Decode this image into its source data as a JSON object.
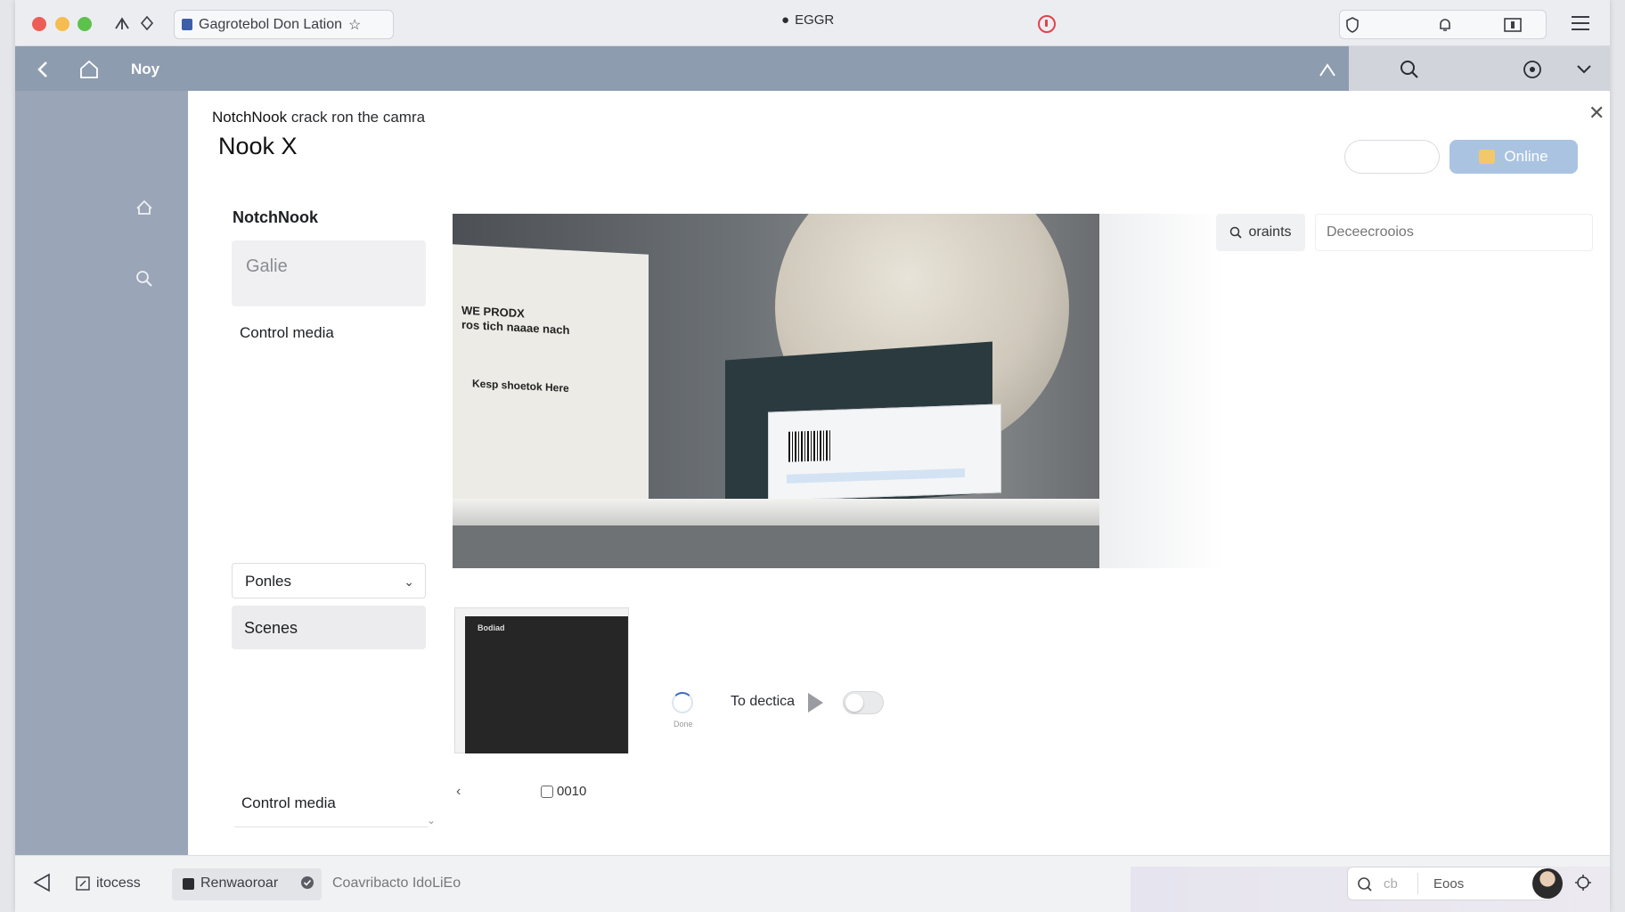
{
  "browser": {
    "url": "Gagrotebol Don Lation",
    "tab_title": "EGGR"
  },
  "appnav": {
    "title": "Noy"
  },
  "panel": {
    "breadcrumb_app": "NotchNook",
    "breadcrumb_text": "crack ron the camra",
    "title": "Nook X",
    "online_button": "Online"
  },
  "left": {
    "section_title": "NotchNook",
    "card_text": "Galie",
    "control_media": "Control media",
    "dropdown_value": "Ponles",
    "scenes": "Scenes",
    "control_media_bottom": "Control media"
  },
  "camera": {
    "book_text_1": "WE PRODX",
    "book_text_2": "ros tich naaae nach",
    "book_text_3": "Kesp shoetok Here"
  },
  "right": {
    "search_chip": "oraints",
    "description_placeholder": "Deceecrooios"
  },
  "thumbnail": {
    "screen_label": "Bodiad"
  },
  "detection": {
    "spinner_label": "Done",
    "label": "To dectica"
  },
  "pager": {
    "count": "0010"
  },
  "bottombar": {
    "item_1": "itocess",
    "chip_label": "Renwaoroar",
    "item_3": "Coavribacto IdoLiEo",
    "search_text": "cb",
    "search_value": "Eoos"
  },
  "colors": {
    "nav": "#8e9cb0",
    "sidebar": "#9aa6b8",
    "accent_button": "#a9c3e0",
    "record": "#e0424e"
  }
}
